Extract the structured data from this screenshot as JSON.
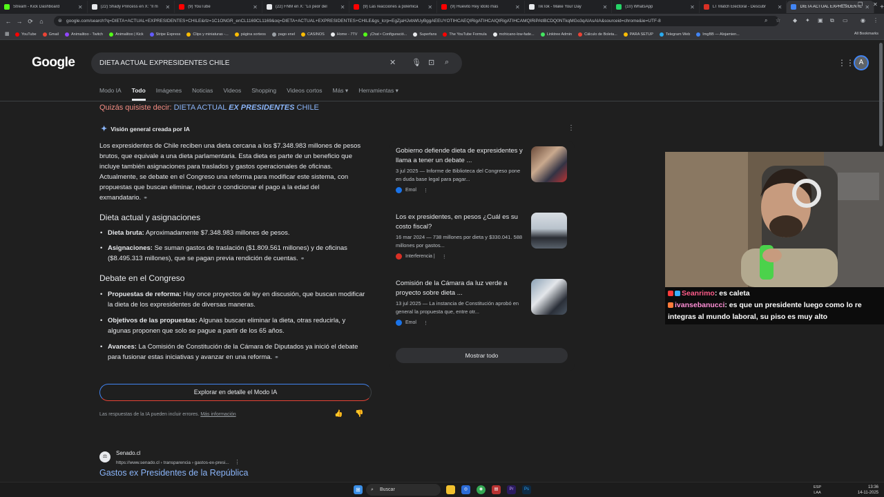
{
  "browser": {
    "tabs": [
      {
        "label": "Stream - Kick Dashboard",
        "color": "#53fc18"
      },
      {
        "label": "(22) Shady Princess en X: \"Il m",
        "color": "#e8eaed"
      },
      {
        "label": "(9) YouTube",
        "color": "#ff0000"
      },
      {
        "label": "(22) FNM en X: \"Lo peor del",
        "color": "#e8eaed"
      },
      {
        "label": "(9) Las reacciones a polémica",
        "color": "#ff0000"
      },
      {
        "label": "(9) Huevito Rey ídolo más",
        "color": "#ff0000"
      },
      {
        "label": "TikTok - Make Your Day",
        "color": "#e8eaed"
      },
      {
        "label": "(10) WhatsApp",
        "color": "#25d366"
      },
      {
        "label": "LT Match Electoral - Descubr",
        "color": "#d93025"
      },
      {
        "label": "DIETA ACTUAL EXPRESIDENTE",
        "color": "#4285f4"
      }
    ],
    "url": "google.com/search?q=DIETA+ACTUAL+EXPRESIDENTES+CHILE&rlz=1C1ONGR_enCL1169CL1169&oq=DIETA+ACTUAL+EXPRESIDENTES+CHILE&gs_lcrp=EgZjaHJvbWUyBggAEEUYOTIHCAEQIRigATIHCAIQIRigATIHCAMQIRiPAtIBCDQ0NTkqMGo3qAIAsAIA&sourceid=chrome&ie=UTF-8",
    "bookmarks": [
      {
        "label": "YouTube",
        "color": "#ff0000"
      },
      {
        "label": "Gmail",
        "color": "#ea4335"
      },
      {
        "label": "Animalitoo - Twitch",
        "color": "#9146ff"
      },
      {
        "label": "Animalitoo | Kick",
        "color": "#53fc18"
      },
      {
        "label": "Stripe Express",
        "color": "#635bff"
      },
      {
        "label": "Clips y miniaturas -...",
        "color": "#fbbc04"
      },
      {
        "label": "página sorteos",
        "color": "#fbbc04"
      },
      {
        "label": "pago enel",
        "color": "#9aa0a6"
      },
      {
        "label": "CASINOS",
        "color": "#fbbc04"
      },
      {
        "label": "Home - 7TV",
        "color": "#e8eaed"
      },
      {
        "label": "¡Chat • Configuració...",
        "color": "#53fc18"
      },
      {
        "label": "Superfans",
        "color": "#e8eaed"
      },
      {
        "label": "The YouTube Formula",
        "color": "#ff0000"
      },
      {
        "label": "mohicano-low-fade...",
        "color": "#e8eaed"
      },
      {
        "label": "Linktree Admin",
        "color": "#43e660"
      },
      {
        "label": "Cálculo de Boleta...",
        "color": "#ea4335"
      },
      {
        "label": "PARA SETUP",
        "color": "#fbbc04"
      },
      {
        "label": "Telegram Web",
        "color": "#2aabee"
      },
      {
        "label": "ImgBB — Alojamien...",
        "color": "#4285f4"
      }
    ],
    "bookmarks_all": "All Bookmarks"
  },
  "google": {
    "logo": "Google",
    "query": "DIETA ACTUAL EXPRESIDENTES CHILE",
    "avatar_letter": "A",
    "tabs": [
      "Modo IA",
      "Todo",
      "Imágenes",
      "Noticias",
      "Videos",
      "Shopping",
      "Videos cortos",
      "Más ▾",
      "Herramientas ▾"
    ],
    "did_you_mean_label": "Quizás quisiste decir:",
    "did_you_mean_a": "DIETA ACTUAL ",
    "did_you_mean_b": "EX PRESIDENTES",
    "did_you_mean_c": " CHILE"
  },
  "ai": {
    "header": "Visión general creada por IA",
    "intro": "Los expresidentes de Chile reciben una dieta cercana a los $7.348.983 millones de pesos brutos, que equivale a una dieta parlamentaria. Esta dieta es parte de un beneficio que incluye también asignaciones para traslados y gastos operacionales de oficinas. Actualmente, se debate en el Congreso una reforma para modificar este sistema, con propuestas que buscan eliminar, reducir o condicionar el pago a la edad del exmandatario.",
    "h_dieta": "Dieta actual y asignaciones",
    "b1_label": "Dieta bruta:",
    "b1_text": " Aproximadamente $7.348.983 millones de pesos.",
    "b2_label": "Asignaciones:",
    "b2_text": " Se suman gastos de traslación ($1.809.561 millones) y de oficinas ($8.495.313 millones), que se pagan previa rendición de cuentas.",
    "h_debate": "Debate en el Congreso",
    "b3_label": "Propuestas de reforma:",
    "b3_text": " Hay once proyectos de ley en discusión, que buscan modificar la dieta de los expresidentes de diversas maneras.",
    "b4_label": "Objetivos de las propuestas:",
    "b4_text": " Algunas buscan eliminar la dieta, otras reducirla, y algunas proponen que solo se pague a partir de los 65 años.",
    "b5_label": "Avances:",
    "b5_text": " La Comisión de Constitución de la Cámara de Diputados ya inició el debate para fusionar estas iniciativas y avanzar en una reforma.",
    "explore": "Explorar en detalle el Modo IA",
    "disclaimer": "Las respuestas de la IA pueden incluir errores. ",
    "more_info": "Más información"
  },
  "side": {
    "cards": [
      {
        "title": "Gobierno defiende dieta de expresidentes y llama a tener un debate ...",
        "desc": "3 jul 2025 — Informe de Biblioteca del Congreso pone en duda base legal para pagar...",
        "source": "Emol",
        "src_color": "#1a73e8"
      },
      {
        "title": "Los ex presidentes, en pesos ¿Cuál es su costo fiscal?",
        "desc": "16 mar 2024 — 738 millones por dieta y $330.041. 588 millones por gastos...",
        "source": "Interferencia |",
        "src_color": "#d93025"
      },
      {
        "title": "Comisión de la Cámara da luz verde a proyecto sobre dieta ...",
        "desc": "13 jul 2025 — La instancia de Constitución aprobó en general la propuesta que, entre otr...",
        "source": "Emol",
        "src_color": "#1a73e8"
      }
    ],
    "show_all": "Mostrar todo"
  },
  "result": {
    "site": "Senado.cl",
    "url": "https://www.senado.cl › transparencia › gastos-ex-presi...",
    "title": "Gastos ex Presidentes de la República"
  },
  "chat": {
    "u1": "Seanrimo",
    "m1": ": es caleta",
    "u2": "ivansebanucci",
    "m2": ": es que un presidente luego como lo re integras al mundo laboral, su piso es muy alto"
  },
  "taskbar": {
    "search": "Buscar",
    "lang1": "ESP",
    "lang2": "LAA",
    "time": "13:36",
    "date": "14-11-2025"
  }
}
